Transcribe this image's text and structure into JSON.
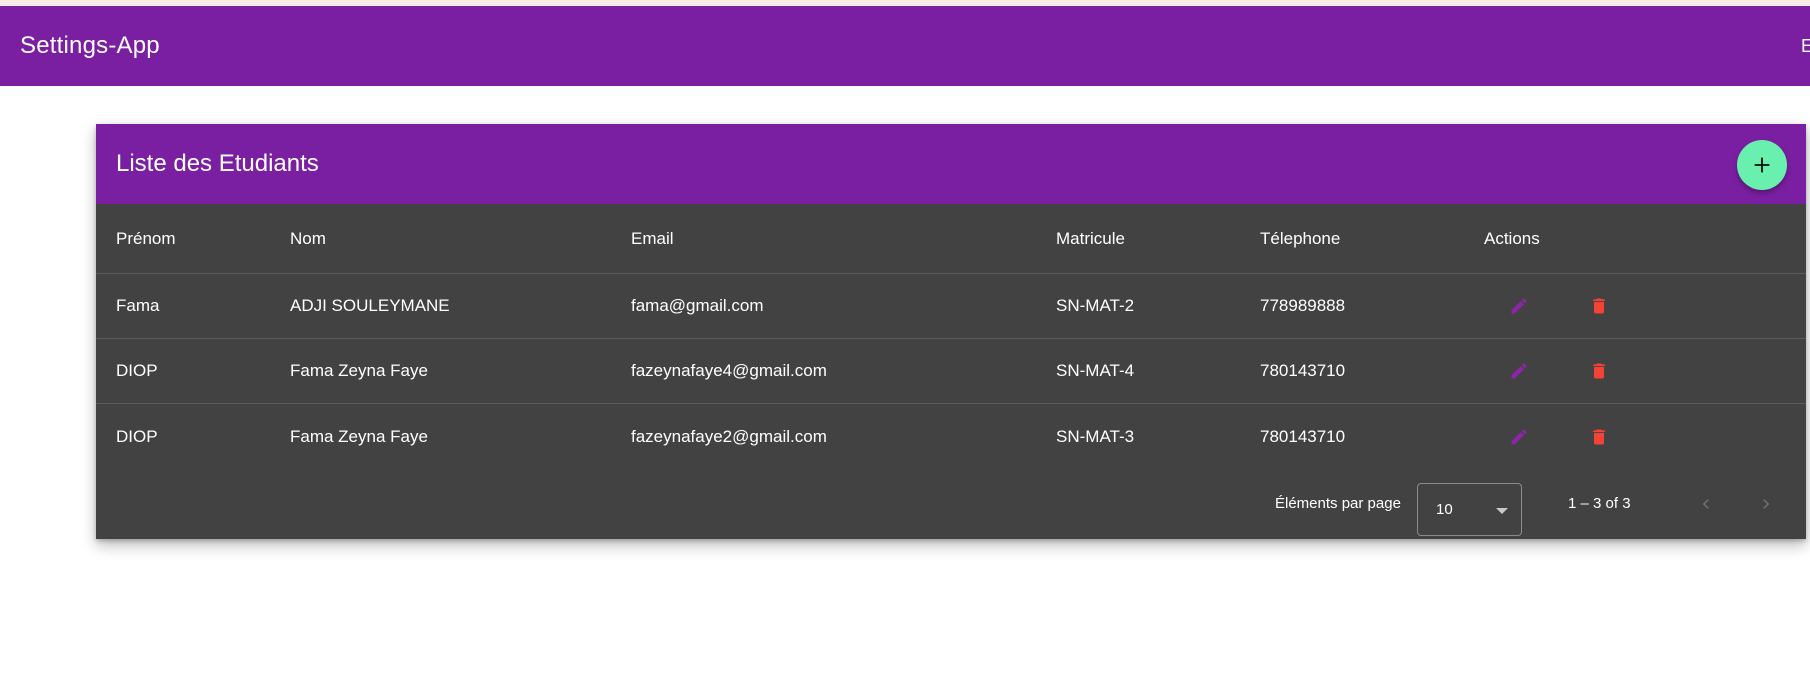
{
  "app": {
    "title": "Settings-App",
    "toolbar_right_text": "E"
  },
  "card": {
    "title": "Liste des Etudiants",
    "add_icon": "plus-icon"
  },
  "table": {
    "headers": {
      "prenom": "Prénom",
      "nom": "Nom",
      "email": "Email",
      "matricule": "Matricule",
      "telephone": "Télephone",
      "actions": "Actions"
    },
    "rows": [
      {
        "prenom": "Fama",
        "nom": "ADJI SOULEYMANE",
        "email": "fama@gmail.com",
        "matricule": "SN-MAT-2",
        "telephone": "778989888"
      },
      {
        "prenom": "DIOP",
        "nom": "Fama Zeyna Faye",
        "email": "fazeynafaye4@gmail.com",
        "matricule": "SN-MAT-4",
        "telephone": "780143710"
      },
      {
        "prenom": "DIOP",
        "nom": "Fama Zeyna Faye",
        "email": "fazeynafaye2@gmail.com",
        "matricule": "SN-MAT-3",
        "telephone": "780143710"
      }
    ],
    "row_action_icons": [
      "pencil-icon",
      "trash-icon"
    ]
  },
  "paginator": {
    "per_page_label": "Éléments par page",
    "per_page_value": "10",
    "range_label": "1 – 3 of 3",
    "prev_icon": "chevron-left-icon",
    "next_icon": "chevron-right-icon"
  },
  "colors": {
    "primary": "#7b1fa2",
    "accent": "#69f0ae",
    "table_bg": "#424242",
    "edit_icon": "#8e24aa",
    "delete_icon": "#f44336",
    "top_strip": "#fbe9e7"
  }
}
